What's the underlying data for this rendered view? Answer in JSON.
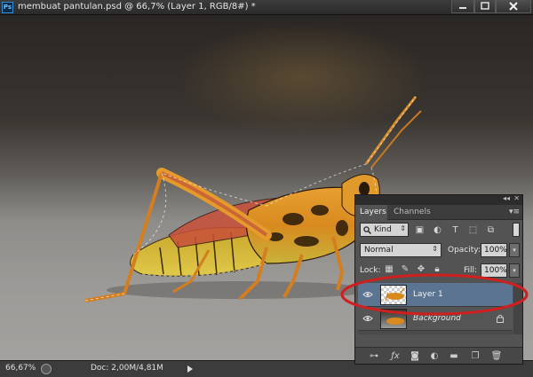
{
  "window": {
    "app_icon": "Ps",
    "title": "membuat pantulan.psd @ 66,7% (Layer 1, RGB/8#) *"
  },
  "status": {
    "zoom": "66,67%",
    "doc_info": "Doc: 2,00M/4,81M"
  },
  "layers_panel": {
    "tabs": [
      "Layers",
      "Channels"
    ],
    "filter_kind": "Kind",
    "blend_mode": "Normal",
    "opacity_label": "Opacity:",
    "opacity_value": "100%",
    "lock_label": "Lock:",
    "fill_label": "Fill:",
    "fill_value": "100%",
    "layers": [
      {
        "name": "Layer 1",
        "visible": true,
        "selected": true
      },
      {
        "name": "Background",
        "visible": true,
        "selected": false,
        "locked": true
      }
    ],
    "footer_icons": [
      "link-icon",
      "fx-icon",
      "mask-icon",
      "adjustment-icon",
      "folder-icon",
      "new-layer-icon",
      "trash-icon"
    ]
  },
  "annotation": {
    "highlight_color": "#d01f1f"
  }
}
